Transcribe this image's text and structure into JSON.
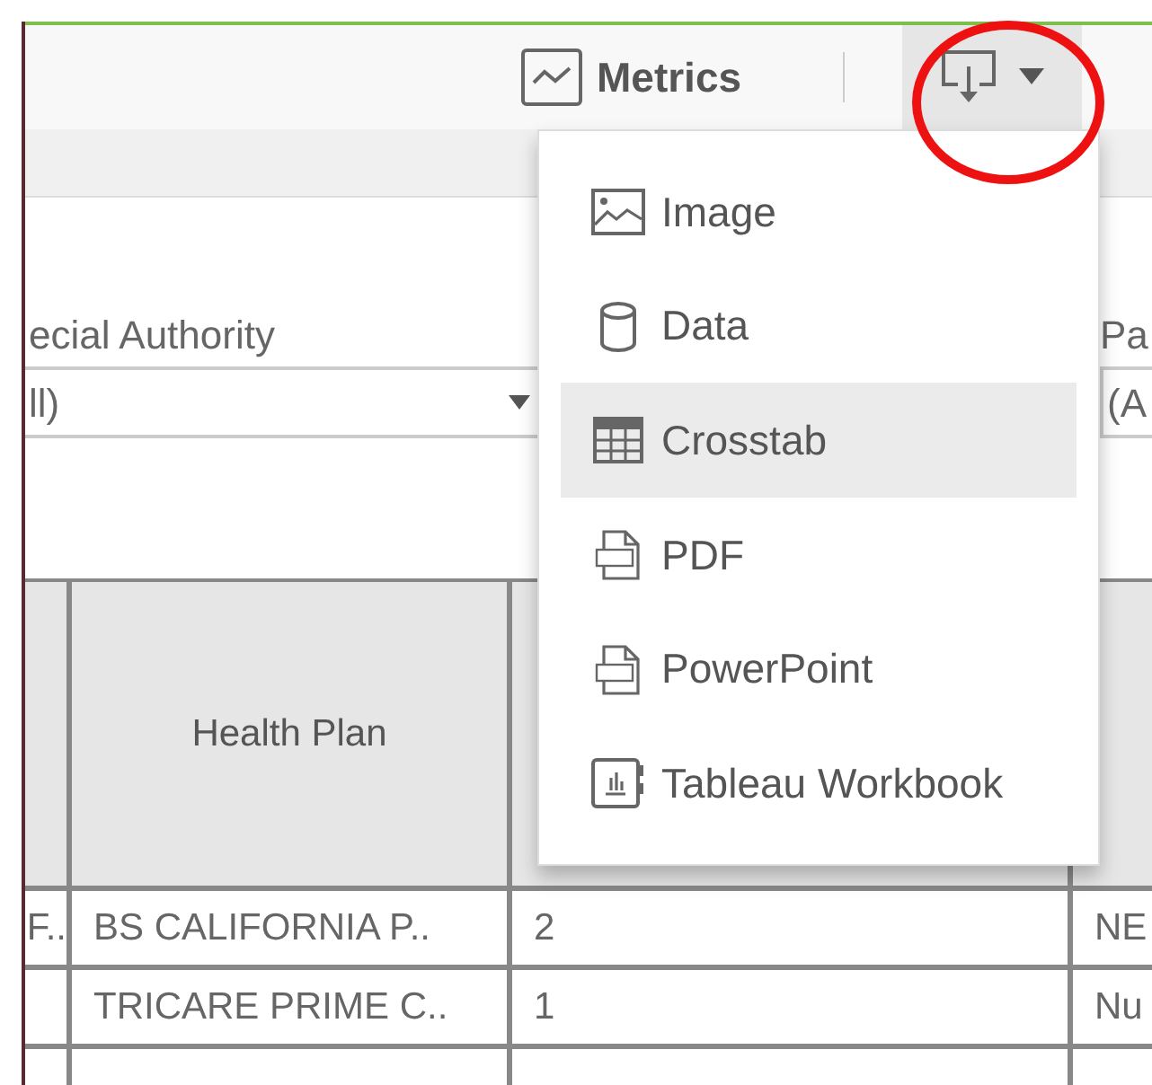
{
  "toolbar": {
    "metrics_label": "Metrics",
    "download_open": true
  },
  "filters": [
    {
      "label": "ecial Authority",
      "value": "ll)"
    },
    {
      "label": "Pa",
      "value": "(A"
    }
  ],
  "download_menu": [
    {
      "label": "Image",
      "kind": "image",
      "selected": false
    },
    {
      "label": "Data",
      "kind": "data",
      "selected": false
    },
    {
      "label": "Crosstab",
      "kind": "crosstab",
      "selected": true
    },
    {
      "label": "PDF",
      "kind": "pdf",
      "selected": false
    },
    {
      "label": "PowerPoint",
      "kind": "ppt",
      "selected": false
    },
    {
      "label": "Tableau Workbook",
      "kind": "workbook",
      "selected": false
    }
  ],
  "table": {
    "columns": [
      {},
      {
        "label": "Health Plan"
      },
      {},
      {}
    ],
    "rows": [
      [
        "F..",
        "BS CALIFORNIA P..",
        "2",
        "NE"
      ],
      [
        null,
        "TRICARE PRIME C..",
        "1",
        "Nu"
      ]
    ]
  },
  "annotation": {
    "kind": "circle"
  }
}
